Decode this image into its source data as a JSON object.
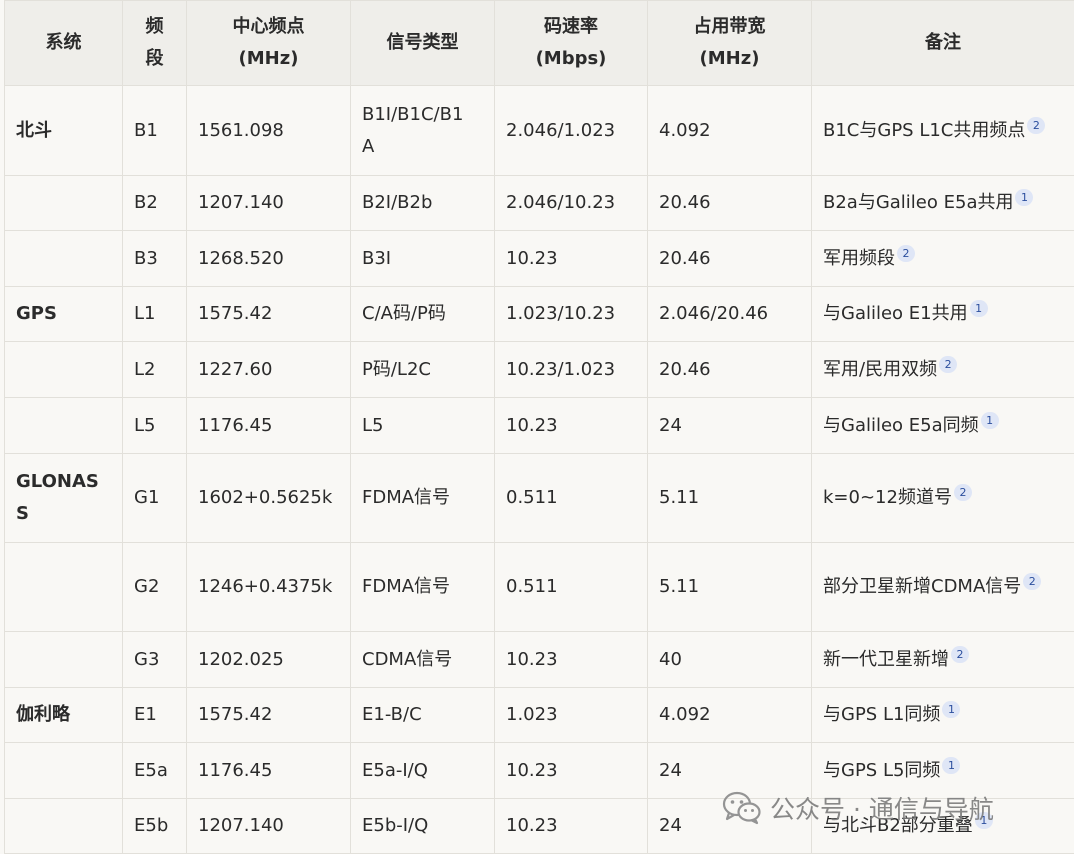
{
  "table": {
    "headers": [
      [
        "系统"
      ],
      [
        "频",
        "段"
      ],
      [
        "中心频点",
        "(MHz)"
      ],
      [
        "信号类型"
      ],
      [
        "码速率",
        "(Mbps)"
      ],
      [
        "占用带宽",
        "(MHz)"
      ],
      [
        "备注"
      ]
    ],
    "rows": [
      {
        "system": [
          "北斗"
        ],
        "band": "B1",
        "freq": "1561.098",
        "signal": [
          "B1I/B1C/B1",
          "A"
        ],
        "rate": "2.046/1.023",
        "bw": "4.092",
        "note": [
          "B1C与GPS L1C共用频点"
        ],
        "ref": "2"
      },
      {
        "system": [
          ""
        ],
        "band": "B2",
        "freq": "1207.140",
        "signal": [
          "B2I/B2b"
        ],
        "rate": "2.046/10.23",
        "bw": "20.46",
        "note": [
          "B2a与Galileo E5a共用"
        ],
        "ref": "1"
      },
      {
        "system": [
          ""
        ],
        "band": "B3",
        "freq": "1268.520",
        "signal": [
          "B3I"
        ],
        "rate": "10.23",
        "bw": "20.46",
        "note": [
          "军用频段"
        ],
        "ref": "2"
      },
      {
        "system": [
          "GPS"
        ],
        "band": "L1",
        "freq": "1575.42",
        "signal": [
          "C/A码/P码"
        ],
        "rate": "1.023/10.23",
        "bw": "2.046/20.46",
        "note": [
          "与Galileo E1共用"
        ],
        "ref": "1"
      },
      {
        "system": [
          ""
        ],
        "band": "L2",
        "freq": "1227.60",
        "signal": [
          "P码/L2C"
        ],
        "rate": "10.23/1.023",
        "bw": "20.46",
        "note": [
          "军用/民用双频"
        ],
        "ref": "2"
      },
      {
        "system": [
          ""
        ],
        "band": "L5",
        "freq": "1176.45",
        "signal": [
          "L5"
        ],
        "rate": "10.23",
        "bw": "24",
        "note": [
          "与Galileo E5a同频"
        ],
        "ref": "1"
      },
      {
        "system": [
          "GLONAS",
          "S"
        ],
        "band": "G1",
        "freq": "1602+0.5625k",
        "signal": [
          "FDMA信号"
        ],
        "rate": "0.511",
        "bw": "5.11",
        "note": [
          "k=0~12频道号"
        ],
        "ref": "2"
      },
      {
        "system": [
          ""
        ],
        "band": "G2",
        "freq": "1246+0.4375k",
        "signal": [
          "FDMA信号"
        ],
        "rate": "0.511",
        "bw": "5.11",
        "note": [
          "部分卫星新增CDMA信号"
        ],
        "ref": "2"
      },
      {
        "system": [
          ""
        ],
        "band": "G3",
        "freq": "1202.025",
        "signal": [
          "CDMA信号"
        ],
        "rate": "10.23",
        "bw": "40",
        "note": [
          "新一代卫星新增"
        ],
        "ref": "2"
      },
      {
        "system": [
          "伽利略"
        ],
        "band": "E1",
        "freq": "1575.42",
        "signal": [
          "E1-B/C"
        ],
        "rate": "1.023",
        "bw": "4.092",
        "note": [
          "与GPS L1同频"
        ],
        "ref": "1"
      },
      {
        "system": [
          ""
        ],
        "band": "E5a",
        "freq": "1176.45",
        "signal": [
          "E5a-I/Q"
        ],
        "rate": "10.23",
        "bw": "24",
        "note": [
          "与GPS L5同频"
        ],
        "ref": "1"
      },
      {
        "system": [
          ""
        ],
        "band": "E5b",
        "freq": "1207.140",
        "signal": [
          "E5b-I/Q"
        ],
        "rate": "10.23",
        "bw": "24",
        "note": [
          "与北斗B2部分重叠"
        ],
        "ref": "1"
      }
    ]
  },
  "watermark": {
    "icon": "wechat-icon",
    "text": "公众号 · 通信与导航"
  }
}
